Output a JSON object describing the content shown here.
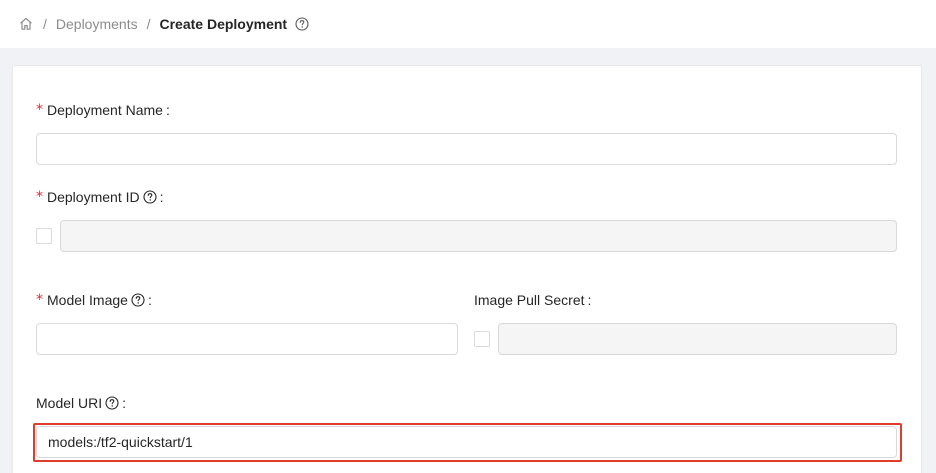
{
  "breadcrumb": {
    "home_icon": "home-icon",
    "separator": "/",
    "items": [
      "Deployments",
      "Create Deployment"
    ],
    "help_icon": "question-circle-icon"
  },
  "form": {
    "deployment_name": {
      "required_mark": "*",
      "label": "Deployment Name",
      "colon": ":",
      "value": "",
      "placeholder": ""
    },
    "deployment_id": {
      "required_mark": "*",
      "label": "Deployment ID",
      "colon": ":",
      "value": "",
      "checkbox_checked": false
    },
    "model_image": {
      "required_mark": "*",
      "label": "Model Image",
      "colon": ":",
      "value": ""
    },
    "image_pull_secret": {
      "label": "Image Pull Secret",
      "colon": ":",
      "value": "",
      "checkbox_checked": false
    },
    "model_uri": {
      "label": "Model URI",
      "colon": ":",
      "value": "models:/tf2-quickstart/1"
    }
  },
  "colors": {
    "required": "#f5222d",
    "highlight": "#e03c2c",
    "background": "#f0f2f5"
  }
}
